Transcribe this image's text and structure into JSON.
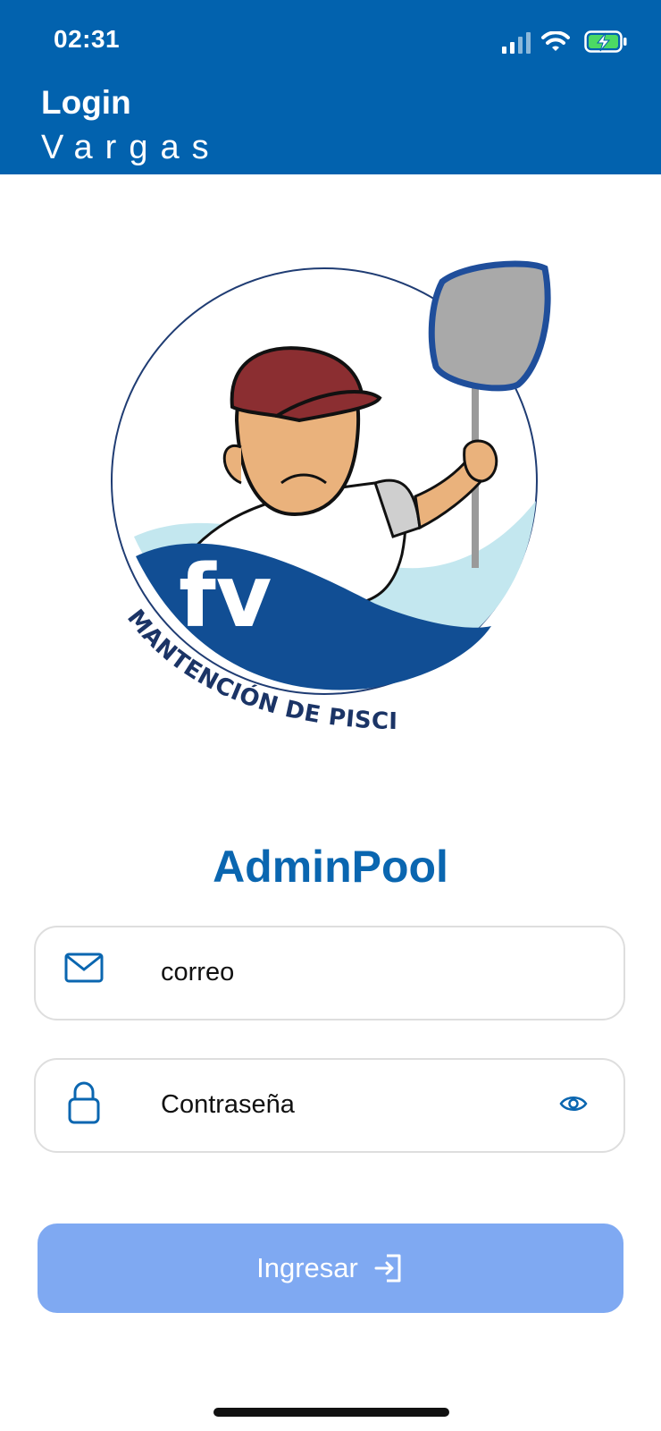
{
  "status_bar": {
    "time": "02:31"
  },
  "header": {
    "title_line1": "Login",
    "title_line2": "Vargas"
  },
  "logo": {
    "monogram": "fv",
    "caption": "MANTENCIÓN DE PISCINAS"
  },
  "app_name": "AdminPool",
  "form": {
    "email_placeholder": "correo",
    "password_placeholder": "Contraseña",
    "submit_label": "Ingresar"
  },
  "colors": {
    "header": "#0262ae",
    "accent": "#0a66b0",
    "button": "#7fa9f2",
    "logo_wave": "#114e94",
    "logo_wave_light": "#c3e7ef",
    "cap": "#8b2e31"
  },
  "icons": [
    "signal-icon",
    "wifi-icon",
    "battery-charging-icon",
    "mail-icon",
    "lock-icon",
    "eye-icon",
    "login-arrow-icon"
  ]
}
